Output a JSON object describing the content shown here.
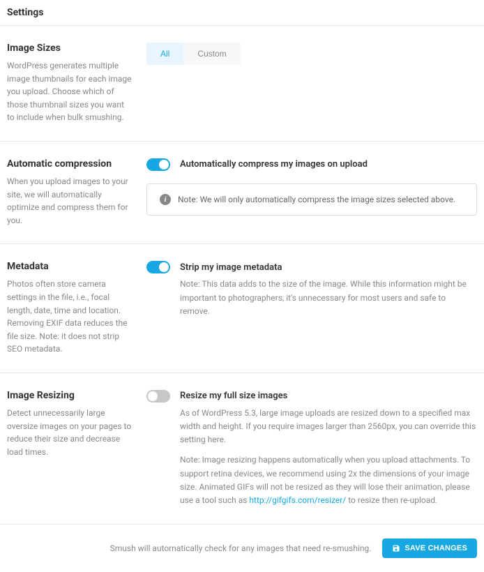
{
  "page_title": "Settings",
  "sections": {
    "image_sizes": {
      "title": "Image Sizes",
      "desc": "WordPress generates multiple image thumbnails for each image you upload. Choose which of those thumbnail sizes you want to include when bulk smushing.",
      "tabs": {
        "all": "All",
        "custom": "Custom"
      }
    },
    "auto_compress": {
      "title": "Automatic compression",
      "desc": "When you upload images to your site, we will automatically optimize and compress them for you.",
      "toggle_label": "Automatically compress my images on upload",
      "notice": "Note: We will only automatically compress the image sizes selected above."
    },
    "metadata": {
      "title": "Metadata",
      "desc": "Photos often store camera settings in the file, i.e., focal length, date, time and location. Removing EXIF data reduces the file size. Note: it does not strip SEO metadata.",
      "toggle_label": "Strip my image metadata",
      "note": "Note: This data adds to the size of the image. While this information might be important to photographers, it's unnecessary for most users and safe to remove."
    },
    "resizing": {
      "title": "Image Resizing",
      "desc": "Detect unnecessarily large oversize images on your pages to reduce their size and decrease load times.",
      "toggle_label": "Resize my full size images",
      "note1": "As of WordPress 5.3, large image uploads are resized down to a specified max width and height. If you require images larger than 2560px, you can override this setting here.",
      "note2_pre": "Note: Image resizing happens automatically when you upload attachments. To support retina devices, we recommend using 2x the dimensions of your image size. Animated GIFs will not be resized as they will lose their animation, please use a tool such as ",
      "note2_link_text": "http://gifgifs.com/resizer/",
      "note2_post": " to resize then re-upload."
    }
  },
  "footer": {
    "note": "Smush will automatically check for any images that need re-smushing.",
    "save_label": "SAVE CHANGES"
  }
}
